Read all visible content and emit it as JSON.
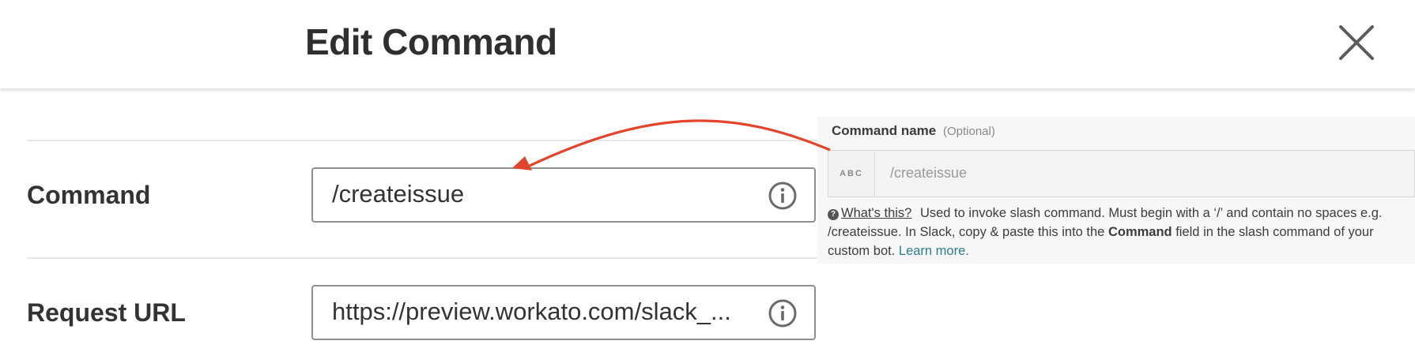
{
  "header": {
    "title": "Edit Command"
  },
  "form": {
    "command": {
      "label": "Command",
      "value": "/createissue"
    },
    "request_url": {
      "label": "Request URL",
      "value": "https://preview.workato.com/slack_..."
    }
  },
  "panel": {
    "label": "Command name",
    "optional": "(Optional)",
    "type_badge": "ABC",
    "placeholder": "/createissue",
    "help_link": "What's this?",
    "help_text_1": "Used to invoke slash command. Must begin with a ‘/’ and contain no spaces e.g. /createissue. In Slack, copy & paste this into the",
    "help_bold": "Command",
    "help_text_2": "field in the slash command of your custom bot.",
    "learn_more": "Learn more."
  },
  "colors": {
    "arrow": "#e2452b",
    "link": "#2e7d8f",
    "field_border": "#8f8f8f"
  },
  "icons": {
    "close": "close-icon",
    "info": "info-icon",
    "help": "question-circle-icon"
  }
}
